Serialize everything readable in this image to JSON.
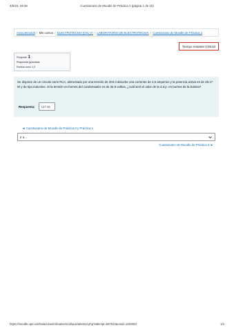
{
  "print_header": {
    "date": "4/5/23, 19:28",
    "title": "Cuestionario de Moodle de Práctica 2 (página 1 de 10)"
  },
  "breadcrumb": {
    "items": [
      {
        "label": "Área personal",
        "link": true
      },
      {
        "label": "Mis cursos",
        "link": false
      },
      {
        "label": "ELECTROTECNIA (GIC-V)",
        "link": true
      },
      {
        "label": "LABORATORIO DE ELECTROTECNIA",
        "link": true
      },
      {
        "label": "Cuestionario de Moodle de Práctica 2",
        "link": true
      }
    ],
    "separator": "/"
  },
  "timer": {
    "text": "Tiempo restante 0:08:53"
  },
  "question_info": {
    "label": "Pregunta",
    "number": "1",
    "status": "Respuesta guardada",
    "grade": "Puntúa como 1,0"
  },
  "question": {
    "text": "Se dispone de un circuito serie RLC, alimentado por una tensión de 204.3 absorbe una corriente de 4.5 amperios y la potencia activa es de 48.17 W y de tipo inductivo. Si la tensión en bornes del condensador es de 34.9 voltios, ¿cuál será el valor de la d.d.p. en bornes de la bobina?",
    "answer_label": "Respuesta:",
    "answer_value": "127.45"
  },
  "navigation": {
    "prev_link": "◄ Cuestionario de Moodle de Práctica 0 y Práctica 1",
    "jump_select": "Ir a...",
    "next_link": "Cuestionario de Moodle de Práctica 3 ►"
  },
  "print_footer": {
    "url": "https://moodle.upm.es/titulaciones/oficiales/mod/quiz/attempt.php?attempt=567913&cmid=1192063",
    "page": "1/2"
  },
  "colors": {
    "link": "#0f6cbf",
    "question_bg": "#e7f3f5",
    "timer_border": "#ca3120"
  },
  "icons": {
    "select_caret": "chevron-down-icon"
  }
}
